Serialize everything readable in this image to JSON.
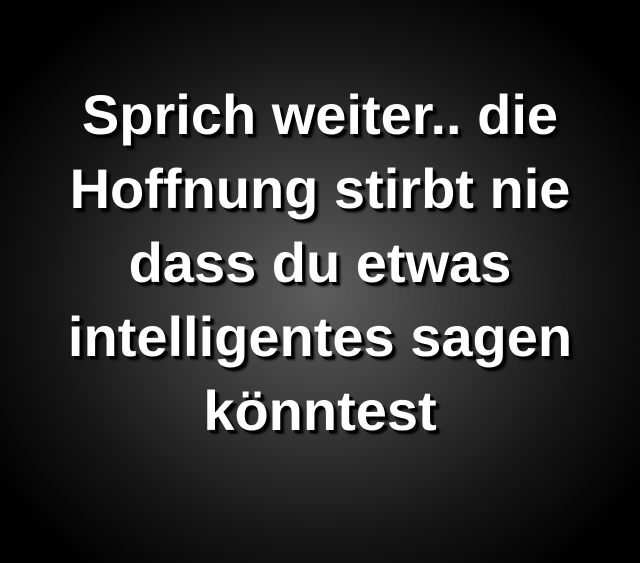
{
  "quote": {
    "lines": [
      "Sprich weiter.. die",
      "Hoffnung stirbt nie",
      "dass du etwas",
      "intelligentes sagen",
      "könntest"
    ]
  },
  "colors": {
    "text": "#ffffff",
    "background_center": "#5e5e5e",
    "background_edge": "#000000"
  }
}
